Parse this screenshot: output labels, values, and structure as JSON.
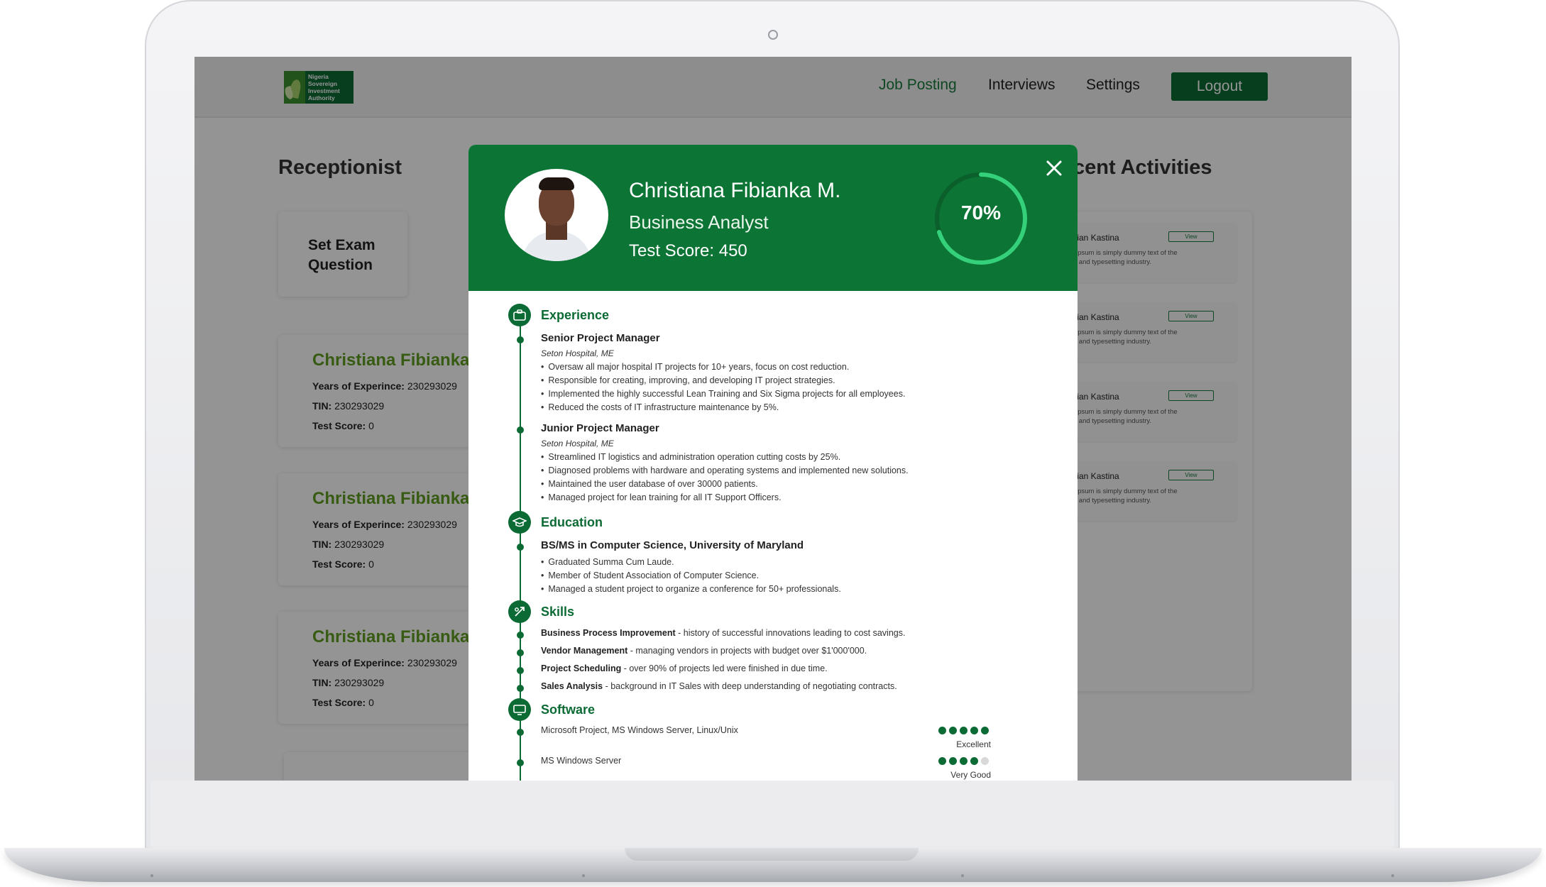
{
  "header": {
    "logo_text": [
      "Nigeria",
      "Sovereign",
      "Investment",
      "Authority"
    ],
    "nav": [
      "Job Posting",
      "Interviews",
      "Settings"
    ],
    "active_nav": "Job Posting",
    "logout": "Logout"
  },
  "left": {
    "title": "Receptionist",
    "set_exam": "Set Exam Question",
    "candidates": [
      {
        "name": "Christiana Fibianka",
        "exp_label": "Years of Experince:",
        "exp": "230293029",
        "tin_label": "TIN:",
        "tin": "230293029",
        "score_label": "Test Score:",
        "score": "0"
      },
      {
        "name": "Christiana Fibianka",
        "exp_label": "Years of Experince:",
        "exp": "230293029",
        "tin_label": "TIN:",
        "tin": "230293029",
        "score_label": "Test Score:",
        "score": "0"
      },
      {
        "name": "Christiana Fibianka",
        "exp_label": "Years of Experince:",
        "exp": "230293029",
        "tin_label": "TIN:",
        "tin": "230293029",
        "score_label": "Test Score:",
        "score": "0"
      }
    ]
  },
  "right": {
    "title_visible": "cent Activities",
    "activities": [
      {
        "name": "Christian Kastina",
        "view": "View",
        "desc": "Lorem Ipsum is simply dummy text of the printing and typesetting industry."
      },
      {
        "name": "Christian Kastina",
        "view": "View",
        "desc": "Lorem Ipsum is simply dummy text of the printing and typesetting industry."
      },
      {
        "name": "Christian Kastina",
        "view": "View",
        "desc": "Lorem Ipsum is simply dummy text of the printing and typesetting industry."
      },
      {
        "name": "Christian Kastina",
        "view": "View",
        "desc": "Lorem Ipsum is simply dummy text of the printing and typesetting industry."
      }
    ]
  },
  "modal": {
    "name": "Christiana Fibianka M.",
    "role": "Business Analyst",
    "test_score": "Test Score: 450",
    "progress_label": "70%",
    "progress_value": 0.7,
    "sections": {
      "experience": "Experience",
      "education": "Education",
      "skills": "Skills",
      "software": "Software"
    },
    "jobs": [
      {
        "title": "Senior Project Manager",
        "place": "Seton Hospital, ME",
        "bullets": [
          "Oversaw all major hospital IT projects for 10+ years, focus on cost reduction.",
          "Responsible for creating, improving, and developing IT project strategies.",
          "Implemented the highly successful Lean Training and Six Sigma projects for all employees.",
          "Reduced the costs of IT infrastructure maintenance by 5%."
        ]
      },
      {
        "title": "Junior Project Manager",
        "place": "Seton Hospital, ME",
        "bullets": [
          "Streamlined IT logistics and administration operation cutting costs by 25%.",
          "Diagnosed problems with hardware and operating systems and implemented new solutions.",
          "Maintained the user database of over 30000 patients.",
          "Managed project for lean training for all IT Support Officers."
        ]
      }
    ],
    "education": {
      "title": "BS/MS in Computer Science, University of Maryland",
      "bullets": [
        "Graduated Summa Cum Laude.",
        "Member of Student Association of Computer Science.",
        "Managed a student project to organize a conference for 50+ professionals."
      ]
    },
    "skills": [
      {
        "name": "Business Process Improvement",
        "desc": " - history of successful innovations leading to cost savings."
      },
      {
        "name": "Vendor Management",
        "desc": " - managing vendors in projects with budget over $1'000'000."
      },
      {
        "name": "Project Scheduling",
        "desc": " - over 90% of projects led were finished in due time."
      },
      {
        "name": "Sales Analysis",
        "desc": " - background in IT Sales with deep understanding of negotiating contracts."
      }
    ],
    "software": [
      {
        "name": "Microsoft Project, MS Windows Server, Linux/Unix",
        "rating": 5,
        "max": 5,
        "label": "Excellent"
      },
      {
        "name": "MS Windows Server",
        "rating": 4,
        "max": 5,
        "label": "Very Good"
      }
    ]
  },
  "colors": {
    "brand": "#0c6b34",
    "header_green": "#0c7434",
    "ring": "#35d07a",
    "candidate_name": "#5f9e1f"
  }
}
